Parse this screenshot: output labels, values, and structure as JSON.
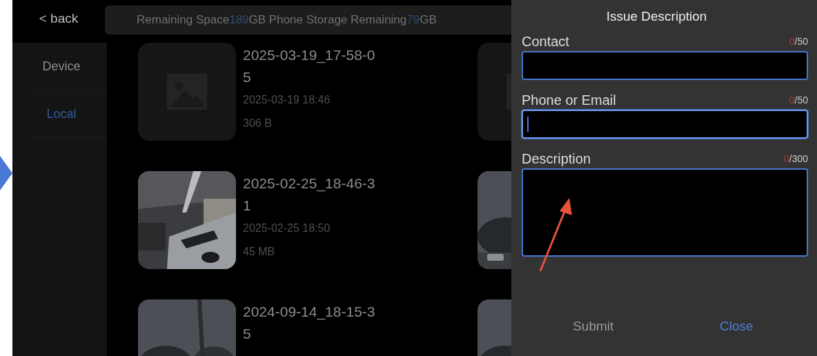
{
  "back": "< back",
  "storage": [
    {
      "text": "Remaining Space",
      "highlight": false
    },
    {
      "text": "189",
      "highlight": true
    },
    {
      "text": "GB Phone Storage Remaining",
      "highlight": false
    },
    {
      "text": "79",
      "highlight": true
    },
    {
      "text": "GB",
      "highlight": false
    }
  ],
  "sidebar": {
    "items": [
      {
        "label": "Device",
        "selected": false
      },
      {
        "label": "Local",
        "selected": true
      }
    ]
  },
  "files": [
    {
      "kind": "placeholder",
      "name": "2025-03-19_17-58-05",
      "date": "2025-03-19 18:46",
      "size": "306 B"
    },
    {
      "kind": "placeholder"
    },
    {
      "kind": "picture",
      "name": "2025-02-25_18-46-31",
      "date": "2025-02-25 18:50",
      "size": "45 MB"
    },
    {
      "kind": "picture"
    },
    {
      "kind": "picture",
      "name": "2024-09-14_18-15-35"
    },
    {
      "kind": "picture"
    }
  ],
  "dialog": {
    "title": "Issue Description",
    "fields": [
      {
        "label": "Contact",
        "count": "0",
        "limit": "/50",
        "kind": "input",
        "focused": false
      },
      {
        "label": "Phone or Email",
        "count": "0",
        "limit": "/50",
        "kind": "input",
        "focused": true
      },
      {
        "label": "Description",
        "count": "0",
        "limit": "/300",
        "kind": "textarea",
        "focused": false
      }
    ],
    "buttons": [
      {
        "label": "Submit",
        "kind": "secondary"
      },
      {
        "label": "Close",
        "kind": "primary"
      }
    ]
  }
}
